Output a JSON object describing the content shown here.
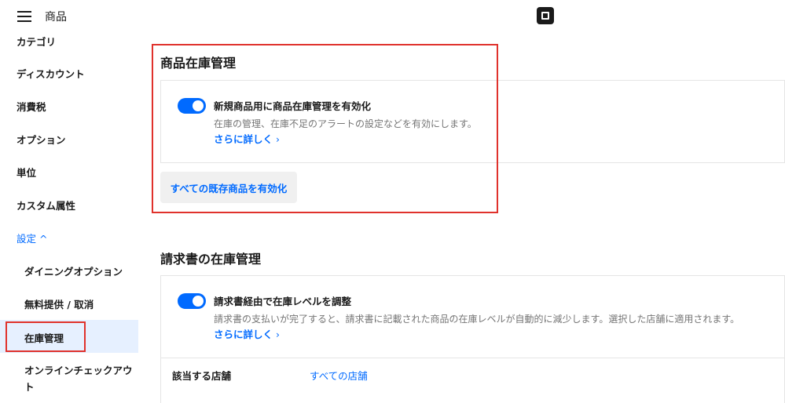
{
  "header": {
    "title": "商品"
  },
  "sidebar": {
    "items": [
      {
        "label": "カテゴリ"
      },
      {
        "label": "ディスカウント"
      },
      {
        "label": "消費税"
      },
      {
        "label": "オプション"
      },
      {
        "label": "単位"
      },
      {
        "label": "カスタム属性"
      },
      {
        "label": "設定 ^"
      },
      {
        "label": "ダイニングオプション"
      },
      {
        "label": "無料提供 / 取消"
      },
      {
        "label": "在庫管理"
      },
      {
        "label": "オンラインチェックアウ"
      },
      {
        "label": "ト"
      }
    ]
  },
  "item_inventory": {
    "title": "商品在庫管理",
    "toggle_label": "新規商品用に商品在庫管理を有効化",
    "toggle_on": true,
    "description": "在庫の管理、在庫不足のアラートの設定などを有効にします。",
    "learn_more": "さらに詳しく",
    "enable_all_button": "すべての既存商品を有効化"
  },
  "invoice_inventory": {
    "title": "請求書の在庫管理",
    "toggle_label": "請求書経由で在庫レベルを調整",
    "toggle_on": true,
    "description": "請求書の支払いが完了すると、請求書に記載された商品の在庫レベルが自動的に減少します。選択した店舗に適用されます。",
    "learn_more": "さらに詳しく",
    "store_label": "該当する店舗",
    "store_value": "すべての店舗"
  },
  "colors": {
    "accent": "#006aff",
    "highlight_box": "#e0322c",
    "active_nav_bg": "#e6f0ff"
  },
  "icons": [
    "hamburger-menu-icon",
    "square-logo-icon",
    "chevron-up-icon",
    "chevron-right-icon"
  ]
}
